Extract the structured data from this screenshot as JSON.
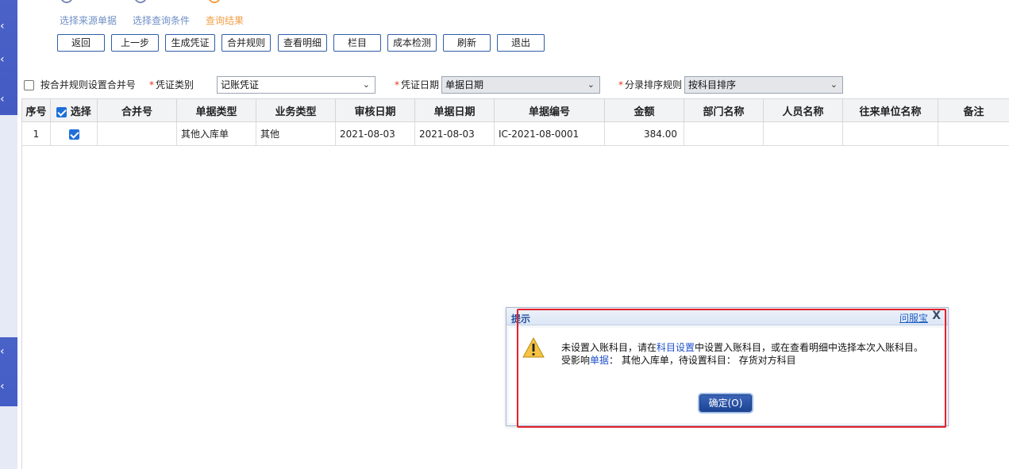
{
  "steps": [
    {
      "label": "选择来源单据",
      "active": false
    },
    {
      "label": "选择查询条件",
      "active": false
    },
    {
      "label": "查询结果",
      "active": true
    }
  ],
  "toolbar": [
    "返回",
    "上一步",
    "生成凭证",
    "合并规则",
    "查看明细",
    "栏目",
    "成本检测",
    "刷新",
    "退出"
  ],
  "filters": {
    "merge_by_rule_label": "按合并规则设置合并号",
    "voucher_type_label": "凭证类别",
    "voucher_type_value": "记账凭证",
    "voucher_date_label": "凭证日期",
    "voucher_date_value": "单据日期",
    "sort_rule_label": "分录排序规则",
    "sort_rule_value": "按科目排序"
  },
  "table": {
    "columns": [
      "序号",
      "选择",
      "合并号",
      "单据类型",
      "业务类型",
      "审核日期",
      "单据日期",
      "单据编号",
      "金额",
      "部门名称",
      "人员名称",
      "往来单位名称",
      "备注"
    ],
    "rows": [
      {
        "seq": "1",
        "selected": true,
        "merge_no": "",
        "doc_type": "其他入库单",
        "biz_type": "其他",
        "audit_date": "2021-08-03",
        "doc_date": "2021-08-03",
        "doc_no": "IC-2021-08-0001",
        "amount": "384.00",
        "dept": "",
        "person": "",
        "partner": "",
        "remark": ""
      }
    ]
  },
  "dialog": {
    "title": "提示",
    "help_link": "问服宝",
    "close_glyph": "X",
    "line1_a": "未设置入账科目，请在",
    "line1_link": "科目设置",
    "line1_b": "中设置入账科目，或在查看明细中选择本次入账科目。",
    "line2_a": "受影响",
    "line2_link": "单据",
    "line2_b": "： 其他入库单，待设置科目： 存货对方科目",
    "ok_label": "确定(O)"
  },
  "colors": {
    "accent": "#f0a047",
    "step_inactive": "#6f8fc6",
    "highlight_border": "#e5202a",
    "link": "#1f4fcc"
  }
}
